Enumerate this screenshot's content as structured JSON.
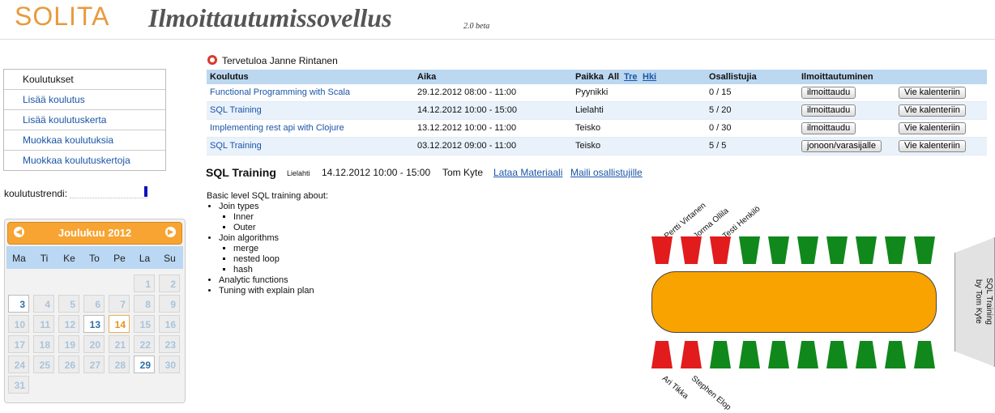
{
  "header": {
    "logo": "SOLITA",
    "title": "Ilmoittautumissovellus",
    "version": "2.0 beta"
  },
  "sidebar": {
    "items": [
      {
        "label": "Koulutukset"
      },
      {
        "label": "Lisää koulutus"
      },
      {
        "label": "Lisää koulutuskerta"
      },
      {
        "label": "Muokkaa koulutuksia"
      },
      {
        "label": "Muokkaa koulutuskertoja"
      }
    ],
    "trend_label": "koulutustrendi:"
  },
  "calendar": {
    "title": "Joulukuu 2012",
    "prev_icon": "chevron-left-icon",
    "next_icon": "chevron-right-icon",
    "weekdays": [
      "Ma",
      "Ti",
      "Ke",
      "To",
      "Pe",
      "La",
      "Su"
    ],
    "days": [
      "1",
      "2",
      "3",
      "4",
      "5",
      "6",
      "7",
      "8",
      "9",
      "10",
      "11",
      "12",
      "13",
      "14",
      "15",
      "16",
      "17",
      "18",
      "19",
      "20",
      "21",
      "22",
      "23",
      "24",
      "25",
      "26",
      "27",
      "28",
      "29",
      "30",
      "31"
    ]
  },
  "welcome": "Tervetuloa Janne Rintanen",
  "table": {
    "headers": {
      "course": "Koulutus",
      "time": "Aika",
      "place": "Paikka",
      "all": "All",
      "tre": "Tre",
      "hki": "Hki",
      "participants": "Osallistujia",
      "registration": "Ilmoittautuminen"
    },
    "rows": [
      {
        "course": "Functional Programming with Scala",
        "time": "29.12.2012 08:00 - 11:00",
        "place": "Pyynikki",
        "participants": "0 / 15",
        "register": "ilmoittaudu",
        "calendar": "Vie kalenteriin"
      },
      {
        "course": "SQL Training",
        "time": "14.12.2012 10:00 - 15:00",
        "place": "Lielahti",
        "participants": "5 / 20",
        "register": "ilmoittaudu",
        "calendar": "Vie kalenteriin"
      },
      {
        "course": "Implementing rest api with Clojure",
        "time": "13.12.2012 10:00 - 11:00",
        "place": "Teisko",
        "participants": "0 / 30",
        "register": "ilmoittaudu",
        "calendar": "Vie kalenteriin"
      },
      {
        "course": "SQL Training",
        "time": "03.12.2012 09:00 - 11:00",
        "place": "Teisko",
        "participants": "5 / 5",
        "register": "jonoon/varasijalle",
        "calendar": "Vie kalenteriin"
      }
    ]
  },
  "detail": {
    "title": "SQL Training",
    "place": "Lielahti",
    "time": "14.12.2012 10:00 - 15:00",
    "teacher": "Tom Kyte",
    "material_link": "Lataa Materiaali",
    "mail_link": "Maili osallistujille",
    "description_intro": "Basic level SQL training about:",
    "topics": {
      "join_types": "Join types",
      "inner": "Inner",
      "outer": "Outer",
      "join_algorithms": "Join algorithms",
      "merge": "merge",
      "nested_loop": "nested loop",
      "hash": "hash",
      "analytic": "Analytic functions",
      "tuning": "Tuning with explain plan"
    }
  },
  "seating": {
    "top_names": [
      "Pertti Virtanen",
      "Jorma Ollila",
      "Testi Henkilö"
    ],
    "bottom_names": [
      "Ari Tikka",
      "Stephen Elop"
    ],
    "top_seats": [
      "red",
      "red",
      "red",
      "green",
      "green",
      "green",
      "green",
      "green",
      "green",
      "green"
    ],
    "bottom_seats": [
      "red",
      "red",
      "green",
      "green",
      "green",
      "green",
      "green",
      "green",
      "green",
      "green"
    ],
    "board_line1": "SQL Training",
    "board_line2": "by Tom Kyte",
    "colors": {
      "taken": "#e21c1c",
      "free": "#11881b",
      "table": "#f8a300"
    }
  }
}
